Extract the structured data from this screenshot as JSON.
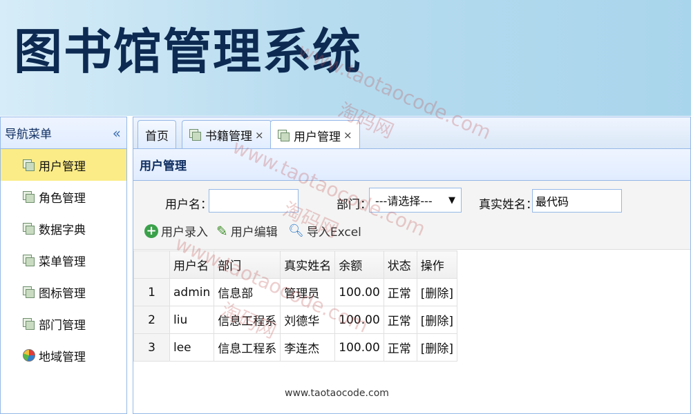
{
  "banner": {
    "title": "图书馆管理系统"
  },
  "sidebar": {
    "title": "导航菜单",
    "collapse": "«",
    "items": [
      {
        "label": "用户管理",
        "icon": "sheet-icon",
        "active": true
      },
      {
        "label": "角色管理",
        "icon": "sheet-icon"
      },
      {
        "label": "数据字典",
        "icon": "sheet-icon"
      },
      {
        "label": "菜单管理",
        "icon": "sheet-icon"
      },
      {
        "label": "图标管理",
        "icon": "sheet-icon"
      },
      {
        "label": "部门管理",
        "icon": "sheet-icon"
      },
      {
        "label": "地域管理",
        "icon": "globe-icon"
      }
    ]
  },
  "tabs": [
    {
      "label": "首页",
      "closable": false
    },
    {
      "label": "书籍管理",
      "closable": true
    },
    {
      "label": "用户管理",
      "closable": true,
      "active": true
    }
  ],
  "tab_close": "×",
  "panel": {
    "title": "用户管理",
    "search": {
      "username_label": "用户名：",
      "username_value": "",
      "dept_label": "部门：",
      "dept_selected": "---请选择---",
      "dept_arrow": "▼",
      "realname_label": "真实姓名：",
      "realname_value": "最代码"
    },
    "actions": {
      "add": "用户录入",
      "edit": "用户编辑",
      "export": "导入Excel"
    },
    "grid": {
      "columns": [
        "用户名",
        "部门",
        "真实姓名",
        "余额",
        "状态",
        "操作"
      ],
      "rows": [
        {
          "num": "1",
          "username": "admin",
          "dept": "信息部",
          "realname": "管理员",
          "balance": "100.00",
          "status": "正常",
          "op": "[删除]"
        },
        {
          "num": "2",
          "username": "liu",
          "dept": "信息工程系",
          "realname": "刘德华",
          "balance": "100.00",
          "status": "正常",
          "op": "[删除]"
        },
        {
          "num": "3",
          "username": "lee",
          "dept": "信息工程系",
          "realname": "李连杰",
          "balance": "100.00",
          "status": "正常",
          "op": "[删除]"
        }
      ]
    }
  },
  "footer": {
    "url": "www.taotaocode.com"
  },
  "watermarks": [
    "www.taotaocode.com",
    "淘码网"
  ],
  "colors": {
    "accent_border": "#95b8e7",
    "active_item": "#fbec88",
    "title_text": "#0d2a52"
  }
}
